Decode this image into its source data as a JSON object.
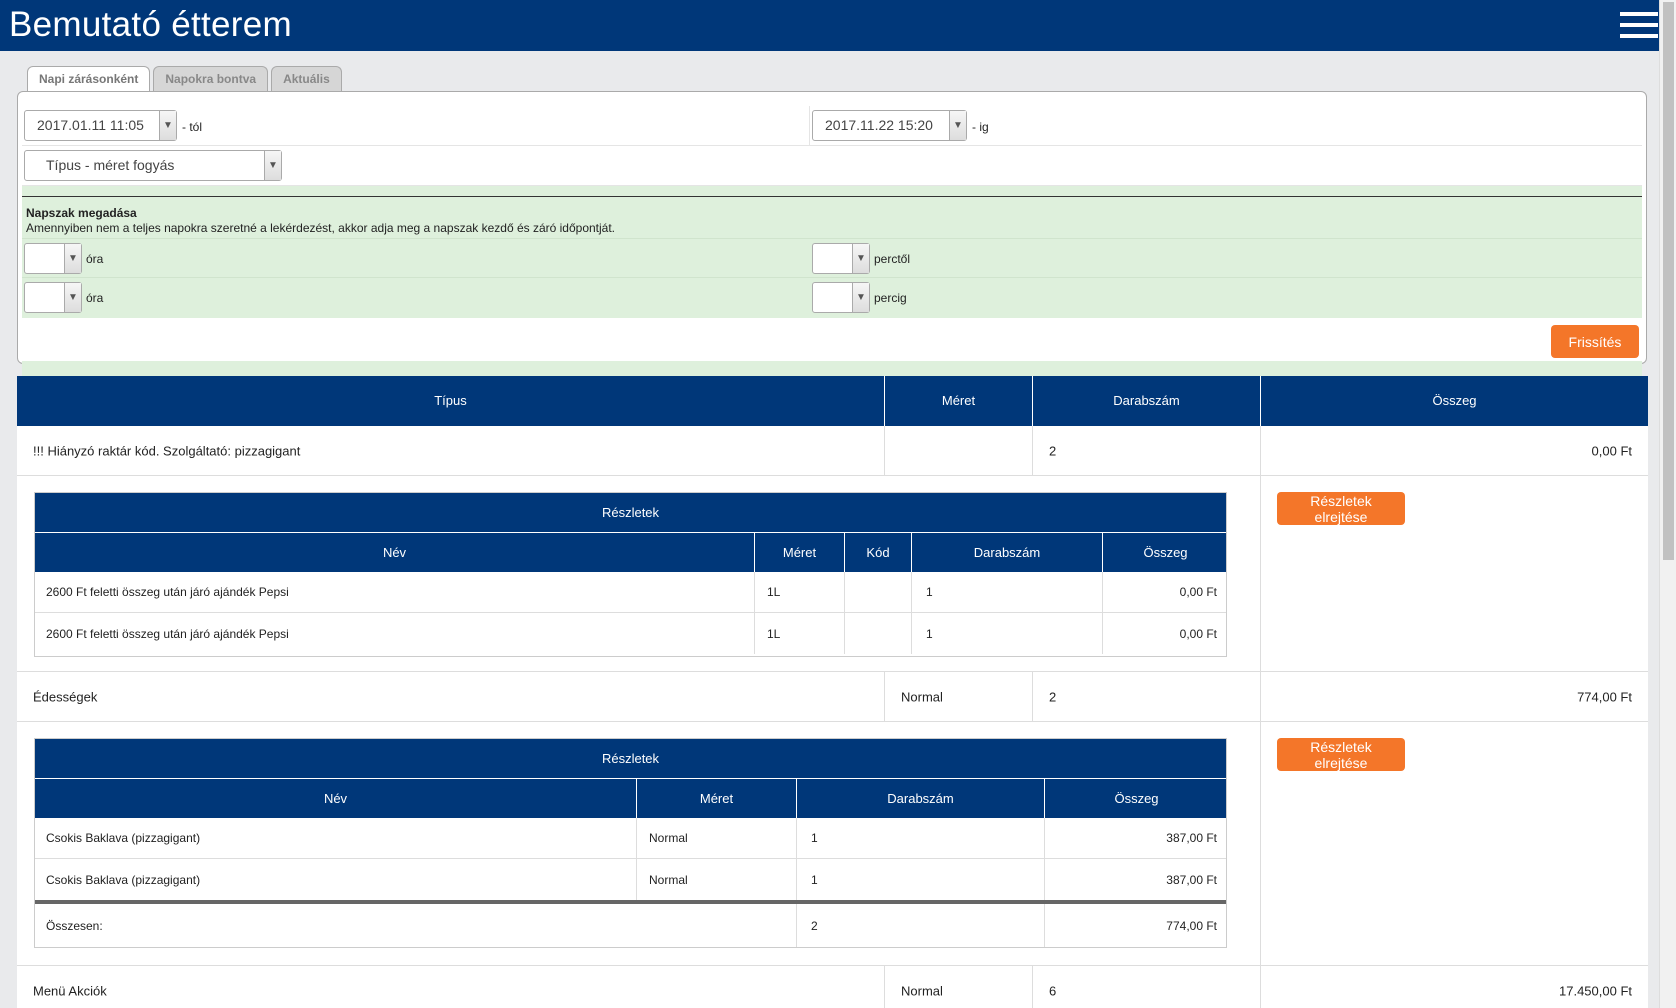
{
  "header": {
    "title": "Bemutató étterem",
    "menu_icon": "hamburger-icon"
  },
  "tabs": [
    {
      "label": "Napi zárásonként",
      "active": true
    },
    {
      "label": "Napokra bontva",
      "active": false
    },
    {
      "label": "Aktuális",
      "active": false
    }
  ],
  "filters": {
    "from_value": "2017.01.11 11:05",
    "from_suffix": "- tól",
    "to_value": "2017.11.22 15:20",
    "to_suffix": "- ig",
    "report_type": "Típus - méret fogyás",
    "napszak_title": "Napszak megadása",
    "napszak_desc": "Amennyiben nem a teljes napokra szeretné a lekérdezést, akkor adja meg a napszak kezdő és záró időpontját.",
    "hour_label_1": "óra",
    "minute_label_1": "perctől",
    "hour_label_2": "óra",
    "minute_label_2": "percig",
    "refresh_label": "Frissítés"
  },
  "table": {
    "headers": [
      "Típus",
      "Méret",
      "Darabszám",
      "Összeg"
    ],
    "rows": [
      {
        "type": "!!! Hiányzó raktár kód. Szolgáltató: pizzagigant",
        "size": "",
        "count": "2",
        "sum": "0,00 Ft"
      },
      {
        "type": "Édességek",
        "size": "Normal",
        "count": "2",
        "sum": "774,00 Ft"
      },
      {
        "type": "Menü Akciók",
        "size": "Normal",
        "count": "6",
        "sum": "17.450,00 Ft"
      }
    ]
  },
  "details1": {
    "title": "Részletek",
    "headers": [
      "Név",
      "Méret",
      "Kód",
      "Darabszám",
      "Összeg"
    ],
    "rows": [
      {
        "name": "2600 Ft feletti összeg után járó ajándék Pepsi",
        "size": "1L",
        "code": "",
        "count": "1",
        "sum": "0,00 Ft"
      },
      {
        "name": "2600 Ft feletti összeg után járó ajándék Pepsi",
        "size": "1L",
        "code": "",
        "count": "1",
        "sum": "0,00 Ft"
      }
    ],
    "hide_label": "Részletek elrejtése"
  },
  "details2": {
    "title": "Részletek",
    "headers": [
      "Név",
      "Méret",
      "Darabszám",
      "Összeg"
    ],
    "rows": [
      {
        "name": "Csokis Baklava (pizzagigant)",
        "size": "Normal",
        "count": "1",
        "sum": "387,00 Ft"
      },
      {
        "name": "Csokis Baklava (pizzagigant)",
        "size": "Normal",
        "count": "1",
        "sum": "387,00 Ft"
      }
    ],
    "total_label": "Összesen:",
    "total_count": "2",
    "total_sum": "774,00 Ft",
    "hide_label": "Részletek elrejtése"
  },
  "colors": {
    "header": "#003779",
    "accent": "#f47629",
    "napszak_bg": "#def0dc",
    "page_bg": "#e9eaec"
  }
}
